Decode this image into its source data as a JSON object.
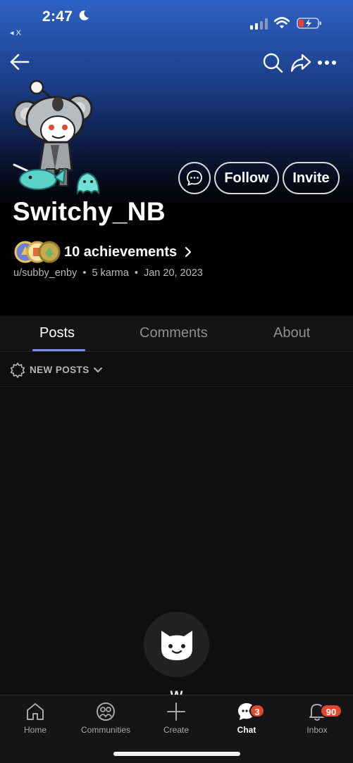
{
  "status_bar": {
    "time": "2:47",
    "back_app": "◂ X"
  },
  "profile": {
    "display_name": "Switchy_NB",
    "achievements_label": "10 achievements",
    "username": "u/subby_enby",
    "karma": "5 karma",
    "joined": "Jan 20, 2023",
    "separator": "•"
  },
  "actions": {
    "follow_label": "Follow",
    "invite_label": "Invite"
  },
  "tabs": [
    {
      "label": "Posts",
      "active": true
    },
    {
      "label": "Comments",
      "active": false
    },
    {
      "label": "About",
      "active": false
    }
  ],
  "sort": {
    "label": "NEW POSTS"
  },
  "empty_state": {
    "text": "W"
  },
  "bottom_nav": [
    {
      "label": "Home",
      "icon": "home-icon"
    },
    {
      "label": "Communities",
      "icon": "communities-icon"
    },
    {
      "label": "Create",
      "icon": "plus-icon"
    },
    {
      "label": "Chat",
      "icon": "chat-icon",
      "badge": "3",
      "active": true
    },
    {
      "label": "Inbox",
      "icon": "bell-icon",
      "badge": "90"
    }
  ],
  "colors": {
    "header_top": "#2f62c4",
    "tab_accent": "#7a8ee6",
    "badge": "#e0482d"
  }
}
